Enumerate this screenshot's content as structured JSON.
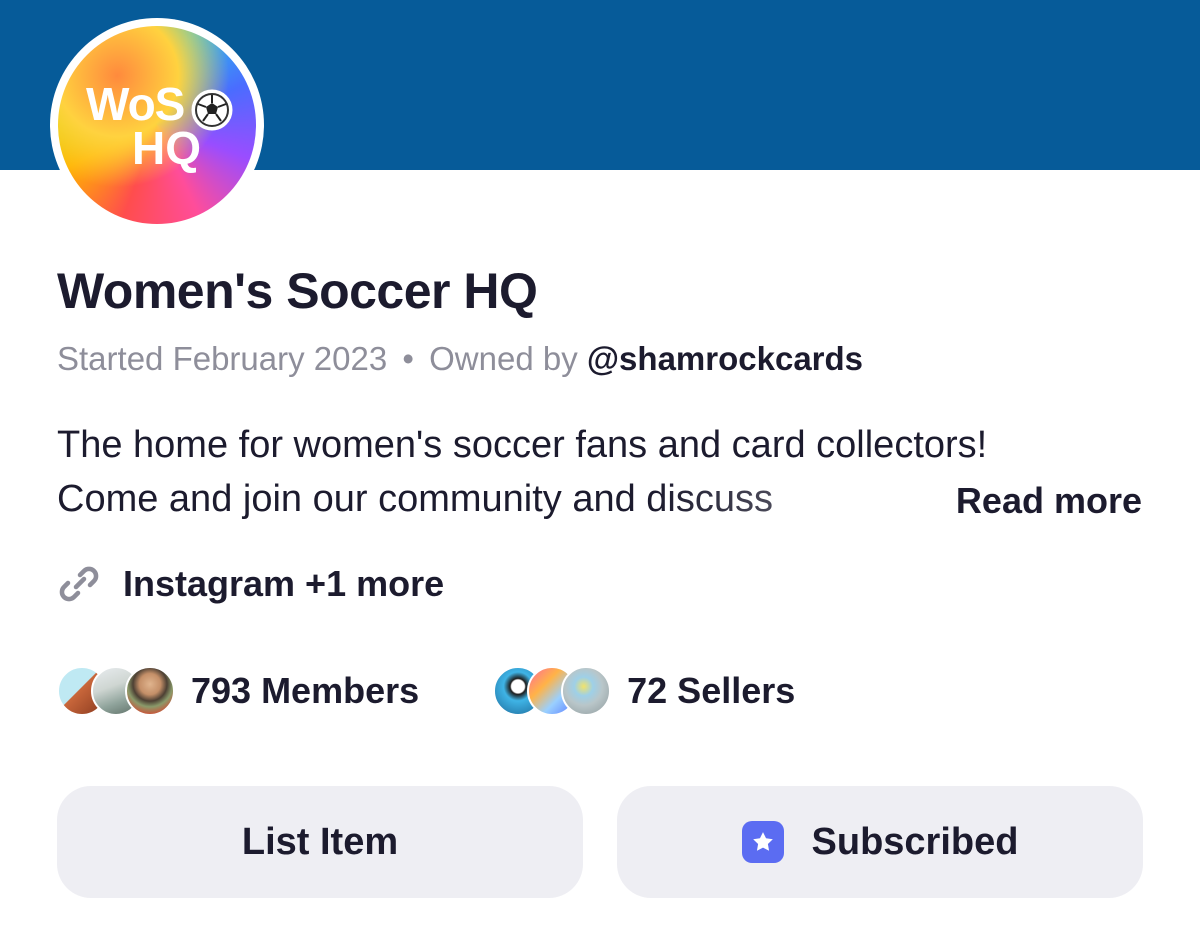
{
  "community": {
    "logo_text_line1": "WoS",
    "logo_text_line2": "HQ",
    "title": "Women's Soccer HQ",
    "started": "Started February 2023",
    "separator": "•",
    "owned_by": "Owned by",
    "owner_handle": "@shamrockcards",
    "description_line1": "The home for women's soccer fans and card collectors!",
    "description_line2": "Come and join our community and discuss",
    "read_more": "Read more",
    "links_label": "Instagram +1 more",
    "members": "793 Members",
    "sellers": "72 Sellers"
  },
  "actions": {
    "list_item": "List Item",
    "subscribed": "Subscribed"
  },
  "colors": {
    "banner": "#065b99",
    "text": "#1c1b2e",
    "muted": "#8e8e9a",
    "button_bg": "#eeeef3",
    "subscribed_badge": "#5b6cf2"
  },
  "icons": {
    "link": "link-icon",
    "star": "star-icon",
    "ball": "soccer-ball-icon"
  }
}
